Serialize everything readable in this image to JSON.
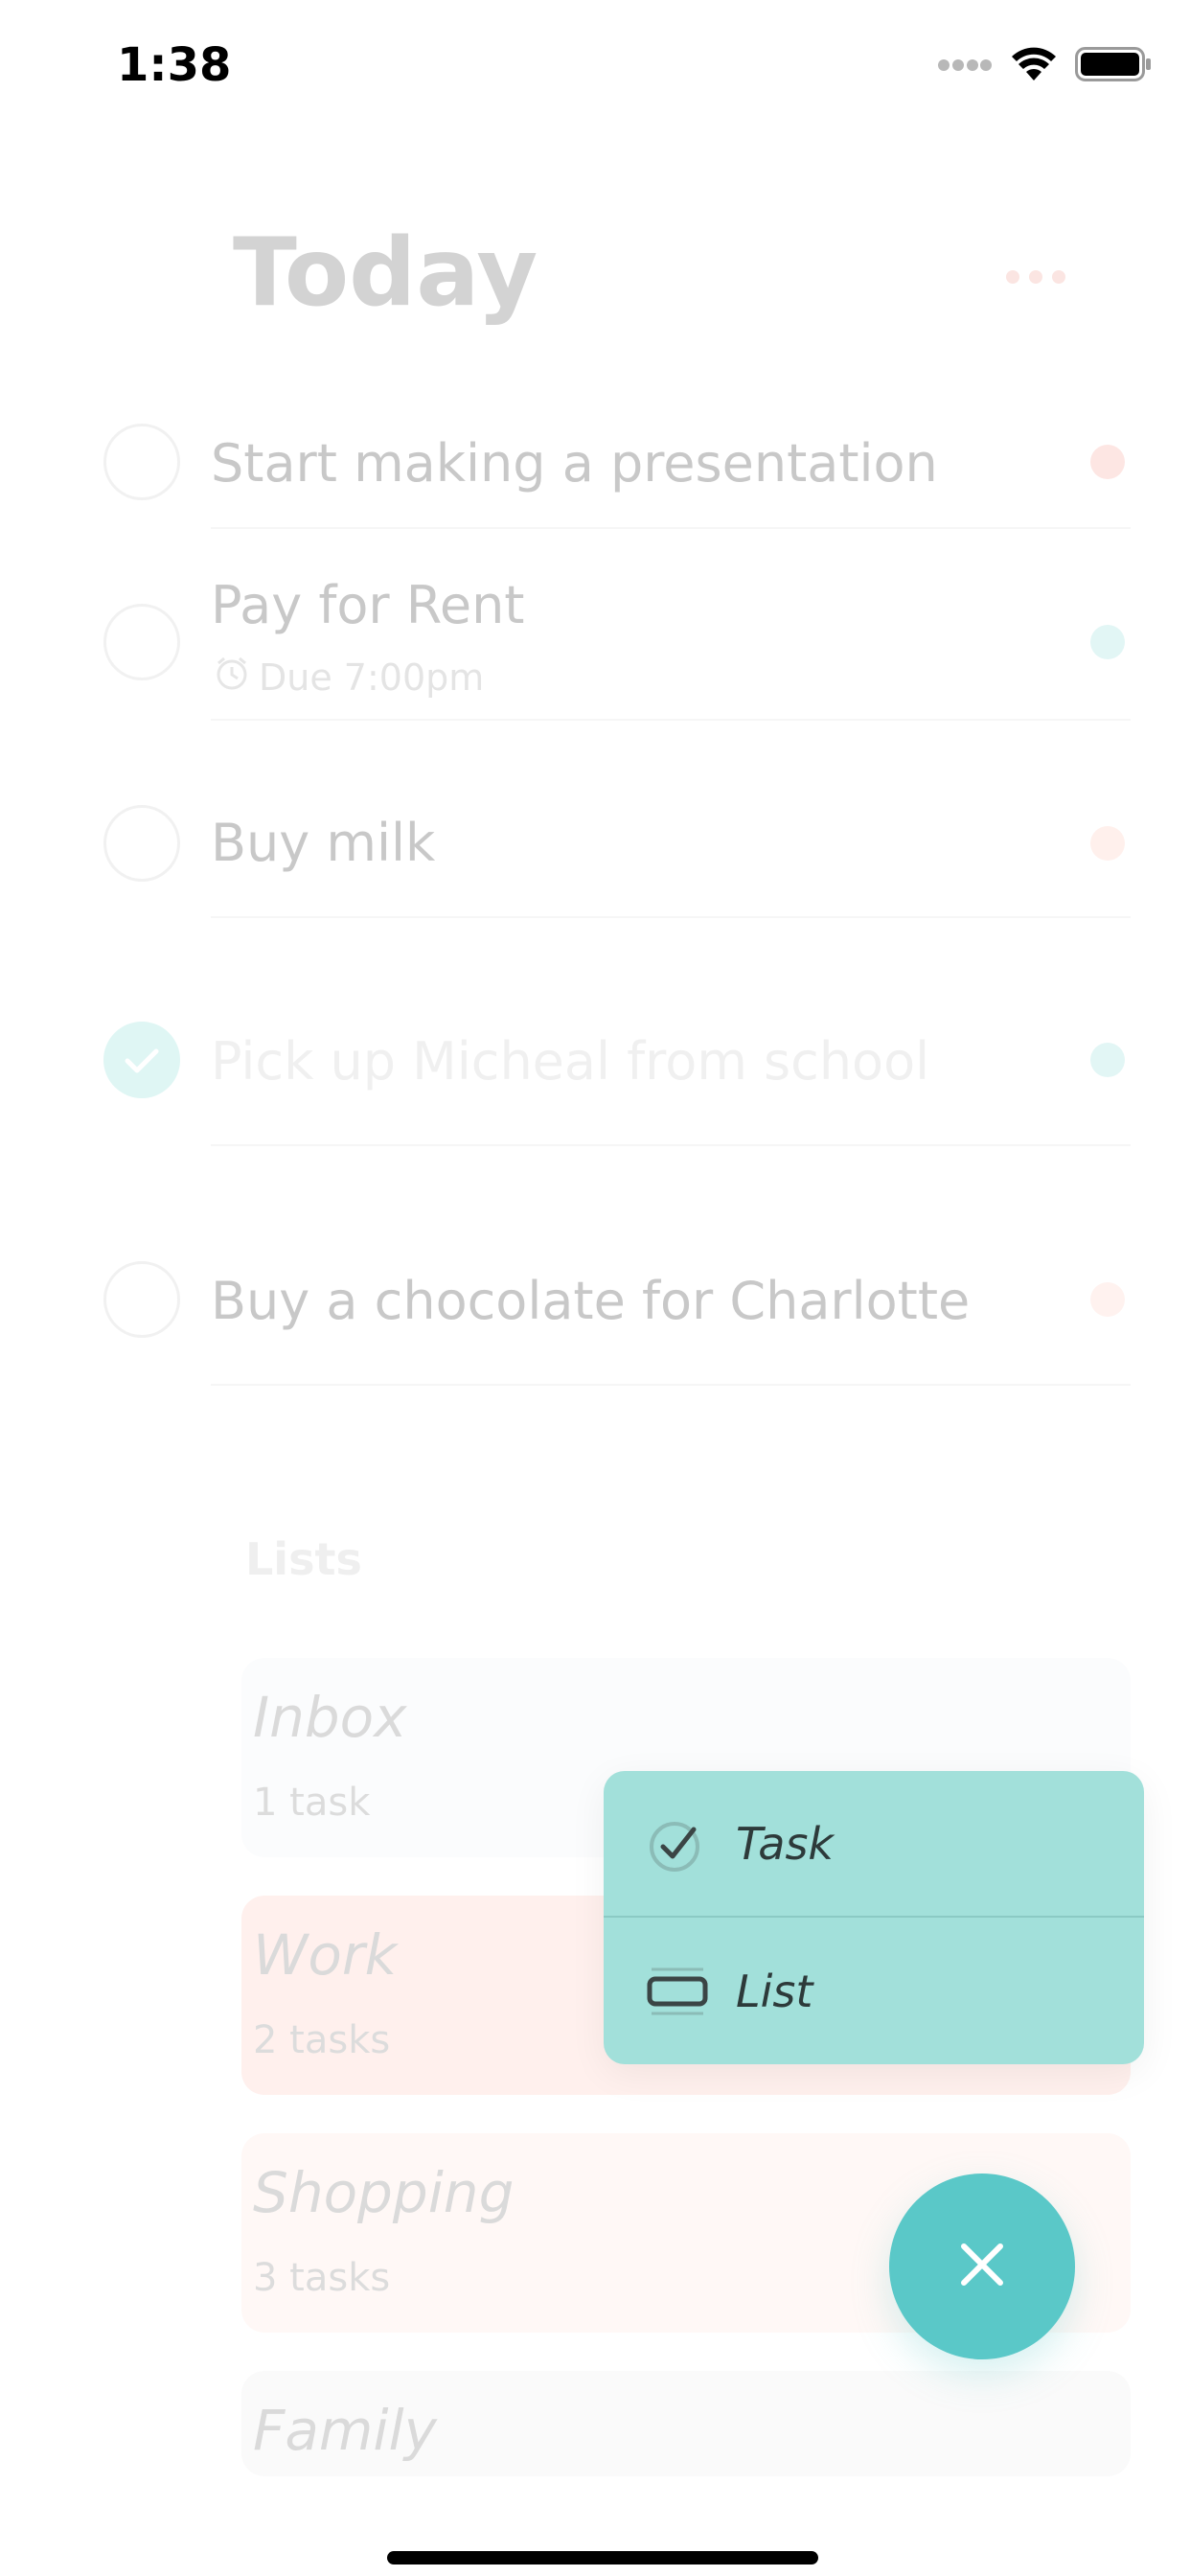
{
  "status_bar": {
    "time": "1:38"
  },
  "header": {
    "title": "Today"
  },
  "tasks": [
    {
      "text": "Start making a presentation",
      "due": "",
      "dot_color": "#fde6e3",
      "done": false
    },
    {
      "text": "Pay for Rent",
      "due": "Due 7:00pm",
      "dot_color": "#e2f6f5",
      "done": false
    },
    {
      "text": "Buy milk",
      "due": "",
      "dot_color": "#fff0ec",
      "done": false
    },
    {
      "text": "Pick up Micheal from school",
      "due": "",
      "dot_color": "#e2f6f5",
      "done": true
    },
    {
      "text": "Buy a chocolate for Charlotte",
      "due": "",
      "dot_color": "#fff2ef",
      "done": false
    }
  ],
  "lists_section": {
    "heading": "Lists",
    "items": [
      {
        "name": "Inbox",
        "count": "1 task",
        "color": "#fbfcfd"
      },
      {
        "name": "Work",
        "count": "2 tasks",
        "color": "#fff0ed"
      },
      {
        "name": "Shopping",
        "count": "3 tasks",
        "color": "#fff8f6"
      },
      {
        "name": "Family",
        "count": "",
        "color": "#fafafa"
      }
    ]
  },
  "popup_menu": {
    "items": [
      {
        "label": "Task",
        "icon": "check-circle-icon"
      },
      {
        "label": "List",
        "icon": "list-card-icon"
      }
    ]
  },
  "fab": {
    "icon": "close-icon",
    "color": "#5ac8c8"
  },
  "colors": {
    "popup_bg": "#a2e0da",
    "fab_bg": "#5ac8c8"
  }
}
